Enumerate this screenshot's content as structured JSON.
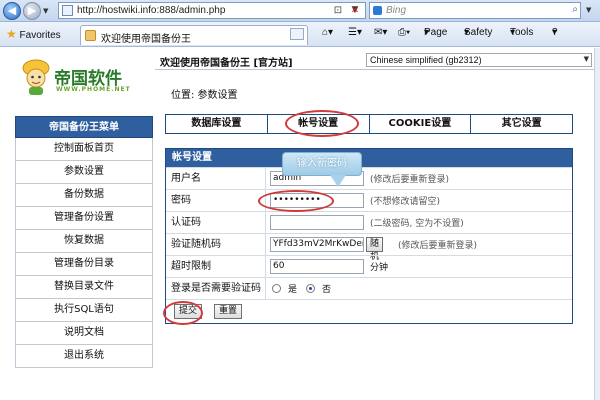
{
  "browser": {
    "url": "http://hostwiki.info:888/admin.php",
    "search_placeholder": "Bing",
    "favorites_label": "Favorites",
    "tab_title": "欢迎使用帝国备份王",
    "toolbar": {
      "page": "Page",
      "safety": "Safety",
      "tools": "Tools",
      "help": "?"
    }
  },
  "logo": {
    "title": "帝国软件",
    "subtitle": "WWW.PHOME.NET"
  },
  "header": {
    "welcome": "欢迎使用帝国备份王 [官方站]",
    "language": "Chinese simplified (gb2312)"
  },
  "location": "位置: 参数设置",
  "sidebar": {
    "title": "帝国备份王菜单",
    "items": [
      "控制面板首页",
      "参数设置",
      "备份数据",
      "管理备份设置",
      "恢复数据",
      "管理备份目录",
      "替换目录文件",
      "执行SQL语句",
      "说明文档",
      "退出系统"
    ]
  },
  "tabs": [
    "数据库设置",
    "帐号设置",
    "COOKIE设置",
    "其它设置"
  ],
  "form": {
    "title": "帐号设置",
    "username": {
      "label": "用户名",
      "value": "admin",
      "hint": "(修改后要重新登录)"
    },
    "password": {
      "label": "密码",
      "value": "•••••••••",
      "hint": "(不想修改请留空)"
    },
    "authcode": {
      "label": "认证码",
      "value": "",
      "hint": "(二级密码, 空为不设置)"
    },
    "random": {
      "label": "验证随机码",
      "value": "YFfd33mV2MrKwDenk",
      "button": "随机",
      "hint": "(修改后要重新登录)"
    },
    "timeout": {
      "label": "超时限制",
      "value": "60",
      "unit": "分钟"
    },
    "captcha": {
      "label": "登录是否需要验证码",
      "yes": "是",
      "no": "否",
      "selected": "no"
    },
    "submit": "提交",
    "reset": "重置"
  },
  "annotation": {
    "callout": "输入新密码"
  },
  "colors": {
    "accent": "#2f5f9e",
    "annotation": "#d23a3a",
    "logo_green": "#2a7a2a"
  }
}
